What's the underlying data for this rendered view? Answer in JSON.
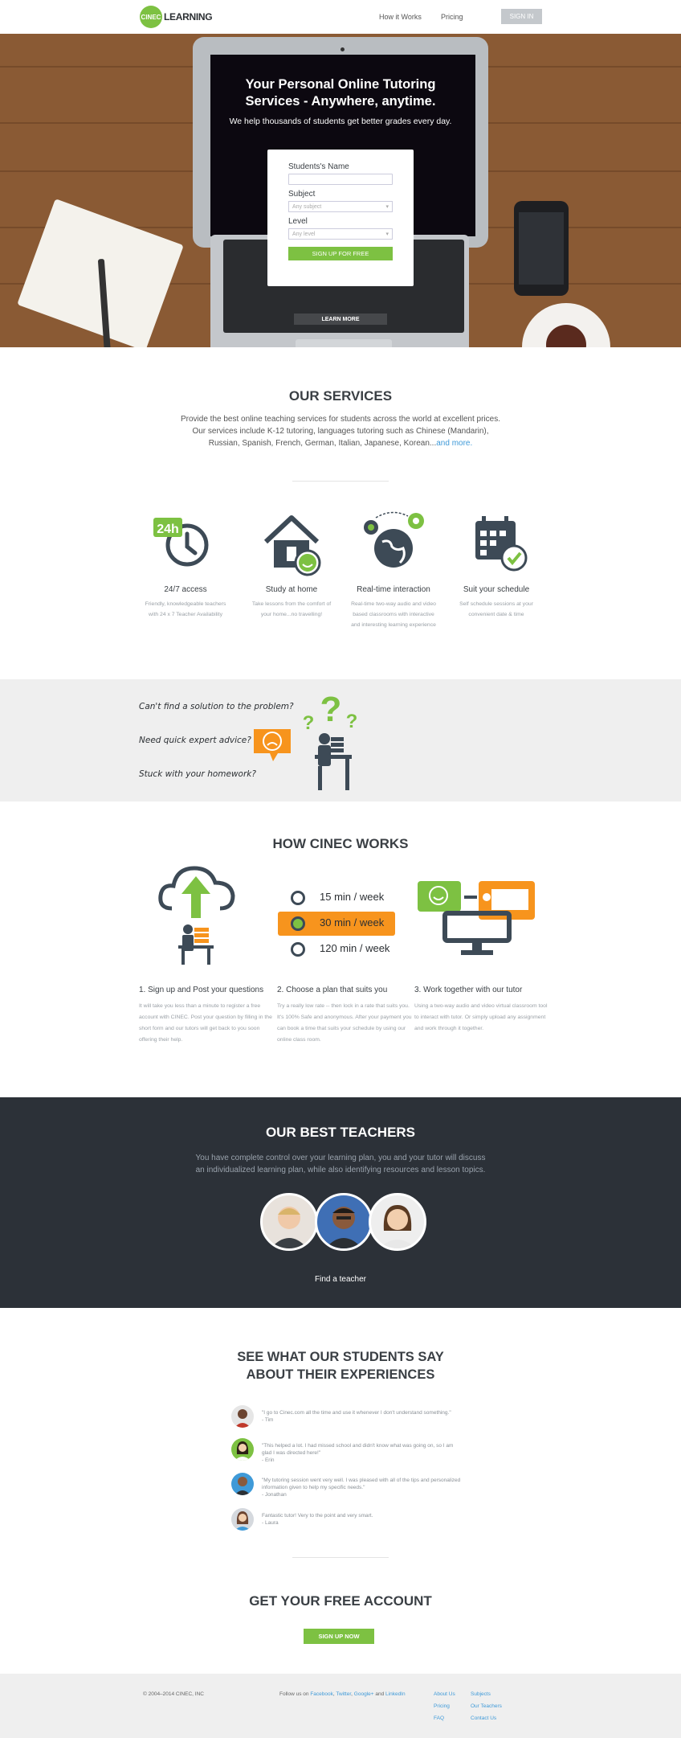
{
  "nav": {
    "logo_badge": "CINEC",
    "logo_text": "LEARNING",
    "links": [
      "How it Works",
      "Pricing"
    ],
    "signin_label": "SIGN IN"
  },
  "hero": {
    "title": "Your Personal Online Tutoring\nServices - Anywhere, anytime.",
    "subtitle": "We help thousands of students get better grades every day.",
    "form": {
      "name_label": "Students's Name",
      "subject_label": "Subject",
      "subject_placeholder": "Any subject",
      "level_label": "Level",
      "level_placeholder": "Any level",
      "submit_label": "SIGN UP FOR FREE"
    },
    "learn_more_label": "LEARN MORE"
  },
  "services": {
    "title": "OUR SERVICES",
    "desc_line1": "Provide the best online teaching services for students across the world at excellent prices.",
    "desc_line2": "Our services include K-12 tutoring, languages tutoring such as Chinese (Mandarin),",
    "desc_line3": "Russian, Spanish, French, German, Italian, Japanese, Korean...",
    "more_link": "and more.",
    "items": [
      {
        "icon": "clock-24h-icon",
        "title": "24/7 access",
        "desc": "Friendly, knowledgeable teachers with 24 x 7 Teacher Availability"
      },
      {
        "icon": "home-study-icon",
        "title": "Study at home",
        "desc": "Take lessons from the comfort of your home...no travelling!"
      },
      {
        "icon": "globe-interaction-icon",
        "title": "Real-time interaction",
        "desc": "Real-time two-way audio and video based classrooms with interactive and interesting learning experience"
      },
      {
        "icon": "calendar-check-icon",
        "title": "Suit your schedule",
        "desc": "Self schedule sessions at your convenient date & time"
      }
    ],
    "badge_24h": "24h"
  },
  "problems": {
    "questions": [
      "Can't find a solution to the problem?",
      "Need quick expert advice?",
      "Stuck with your homework?"
    ]
  },
  "how": {
    "title": "HOW CINEC WORKS",
    "plans": [
      "15 min / week",
      "30 min / week",
      "120 min / week"
    ],
    "steps": [
      {
        "title": "1. Sign up and Post your questions",
        "desc": "It will take you less than a minute to register a free account with CINEC. Post your question by filling in the short form and our tutors will get back to you soon offering their help."
      },
      {
        "title": "2. Choose a plan that suits you",
        "desc": "Try a really low rate -- then lock in a rate that suits you. It's 100% Safe and anonymous. After your payment you can book a time that suits your schedule by using our online class room."
      },
      {
        "title": "3. Work together with our tutor",
        "desc": "Using a two-way audio and video virtual classroom tool to interact with tutor. Or simply upload any assignment and work through it together."
      }
    ]
  },
  "teachers": {
    "title": "OUR BEST TEACHERS",
    "desc_line1": "You have complete control over your learning plan, you and your tutor will discuss",
    "desc_line2": "an individualized learning plan, while also identifying resources and lesson topics.",
    "find_label": "Find a teacher"
  },
  "testimonials": {
    "title_line1": "SEE WHAT OUR STUDENTS SAY",
    "title_line2": "ABOUT THEIR EXPERIENCES",
    "items": [
      {
        "quote": "\"I go to Cinec.com all the time and use it whenever I don't understand something.\"",
        "author": "- Tim"
      },
      {
        "quote": "\"This helped a lot. I had missed school and didn't know what was going on, so I am glad I was directed here!\"",
        "author": "- Erin"
      },
      {
        "quote": "\"My tutoring session went very well. I was pleased with all of the tips and personalized information given to help my specific needs.\"",
        "author": "- Jonathan"
      },
      {
        "quote": "Fantastic tutor! Very to the point and very smart.",
        "author": "- Laura"
      }
    ]
  },
  "cta": {
    "title": "GET YOUR FREE ACCOUNT",
    "button_label": "SIGN UP NOW"
  },
  "footer": {
    "copyright": "© 2004–2014 CINEC, INC",
    "follow_prefix": "Follow us on",
    "facebook": "Facebook",
    "twitter": "Twitter",
    "googleplus": "Google+",
    "and_word": "and",
    "linkedin": "LinkedIn",
    "col1": [
      "About Us",
      "Pricing",
      "FAQ"
    ],
    "col2": [
      "Subjects",
      "Our Teachers",
      "Contact Us"
    ]
  },
  "colors": {
    "accent_green": "#7dc142",
    "accent_orange": "#f7941d",
    "dark": "#2c3138",
    "link_blue": "#3f9ad8"
  }
}
